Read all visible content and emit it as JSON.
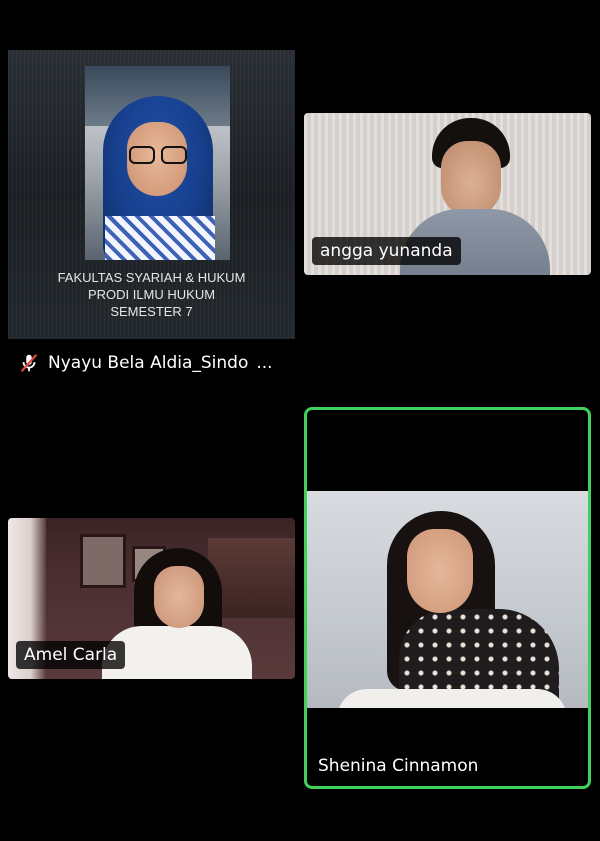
{
  "participants": [
    {
      "name": "Nyayu Bela Aldia_Sindo",
      "more": "...",
      "muted": true,
      "card_lines": [
        "FAKULTAS SYARIAH & HUKUM",
        "PRODI ILMU HUKUM",
        "SEMESTER 7"
      ]
    },
    {
      "name": "angga yunanda",
      "muted": false
    },
    {
      "name": "Amel Carla",
      "muted": false
    },
    {
      "name": "Shenina Cinnamon",
      "muted": false,
      "active_speaker": true
    }
  ],
  "colors": {
    "background": "#000000",
    "active_speaker_border": "#3fd15a",
    "label_text": "#ffffff",
    "mic_off": "#e5483f"
  },
  "icons": {
    "muted_indicator": "mic-off-icon"
  }
}
